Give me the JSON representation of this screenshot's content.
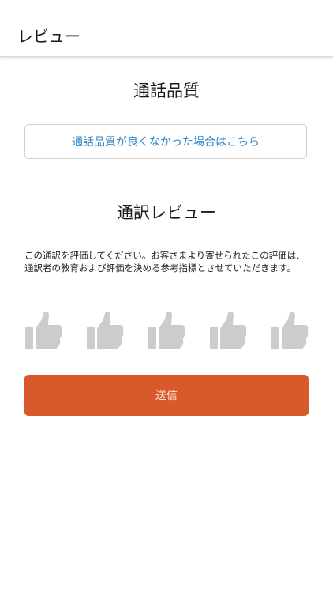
{
  "header": {
    "title": "レビュー"
  },
  "call_quality": {
    "title": "通話品質",
    "link_label": "通話品質が良くなかった場合はこちら"
  },
  "review": {
    "title": "通訳レビュー",
    "description": "この通訳を評価してください。お客さまより寄せられたこの評価は、通訳者の教育および評価を決める参考指標とさせていただきます。",
    "rating": {
      "selected": 0,
      "max": 5
    }
  },
  "submit_label": "送信",
  "colors": {
    "accent": "#d85a2a",
    "link": "#2f86c8",
    "thumb_inactive": "#cccccc"
  },
  "icons": {
    "rating": "thumbs-up-icon"
  }
}
